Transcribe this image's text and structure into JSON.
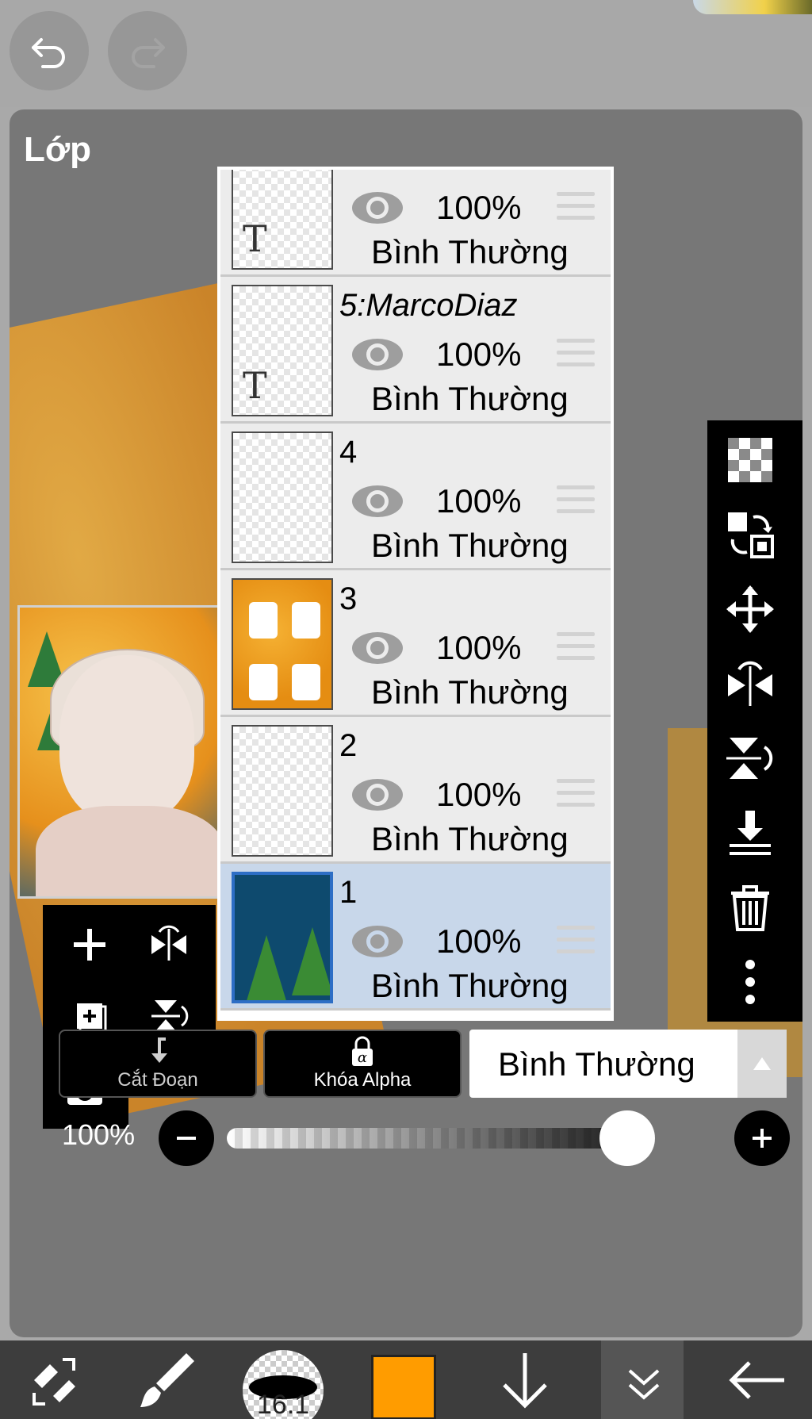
{
  "panel": {
    "title": "Lớp"
  },
  "layers": [
    {
      "name": "",
      "opacity": "100%",
      "blend": "Bình Thường",
      "thumb": "text",
      "selected": false
    },
    {
      "name": "5:MarcoDiaz",
      "opacity": "100%",
      "blend": "Bình Thường",
      "thumb": "text",
      "selected": false
    },
    {
      "name": "4",
      "opacity": "100%",
      "blend": "Bình Thường",
      "thumb": "empty",
      "selected": false
    },
    {
      "name": "3",
      "opacity": "100%",
      "blend": "Bình Thường",
      "thumb": "orange",
      "selected": false
    },
    {
      "name": "2",
      "opacity": "100%",
      "blend": "Bình Thường",
      "thumb": "empty",
      "selected": false
    },
    {
      "name": "1",
      "opacity": "100%",
      "blend": "Bình Thường",
      "thumb": "blue",
      "selected": true
    }
  ],
  "thumb_text_glyph": "T",
  "controls": {
    "clipping_label": "Cắt Đoạn",
    "alpha_lock_label": "Khóa Alpha",
    "blend_mode_value": "Bình Thường",
    "opacity_label": "100%",
    "opacity_value": 1.0
  },
  "bottombar": {
    "brush_size": "16.1",
    "color": "#ff9c00"
  },
  "icons": {
    "top": [
      "undo-icon",
      "redo-icon"
    ],
    "left_tools": [
      "add-layer-icon",
      "flip-horizontal-icon",
      "duplicate-layer-icon",
      "flip-vertical-icon",
      "camera-icon"
    ],
    "right_tools": [
      "transparency-icon",
      "swap-icon",
      "move-icon",
      "flip-horizontal-icon",
      "flip-vertical-icon",
      "merge-down-icon",
      "trash-icon",
      "more-icon"
    ],
    "bottom": [
      "transform-icon",
      "brush-icon",
      "brush-size",
      "color-swatch",
      "arrow-down-icon",
      "chevron-double-down-icon",
      "back-arrow-icon"
    ]
  }
}
